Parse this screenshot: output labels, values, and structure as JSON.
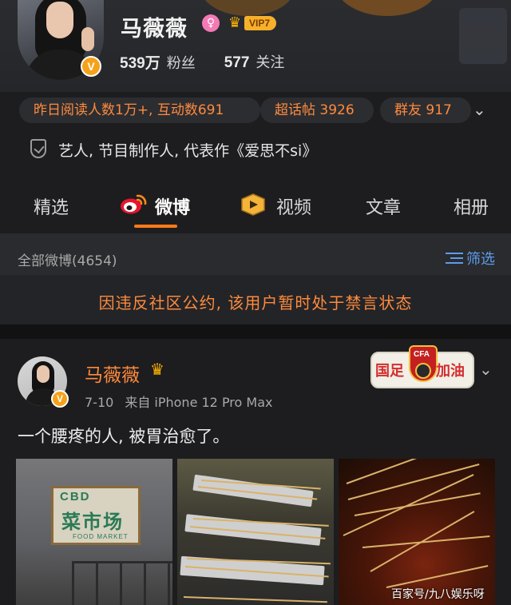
{
  "profile": {
    "name": "马薇薇",
    "vip_label": "VIP7",
    "followers_count": "539万",
    "followers_label": "粉丝",
    "following_count": "577",
    "following_label": "关注"
  },
  "metrics": {
    "reads": "昨日阅读人数1万+, 互动数691",
    "super_topic": "超话帖 3926",
    "group_friends": "群友 917"
  },
  "intro": {
    "text": "艺人, 节目制作人, 代表作《爱思不si》"
  },
  "tabs": [
    {
      "label": "精选"
    },
    {
      "label": "微博"
    },
    {
      "label": "视频"
    },
    {
      "label": "文章"
    },
    {
      "label": "相册"
    }
  ],
  "feed": {
    "title": "全部微博(4654)",
    "filter_label": "筛选"
  },
  "notice": {
    "text": "因违反社区公约, 该用户暂时处于禁言状态"
  },
  "post": {
    "author": "马薇薇",
    "date": "7-10",
    "source": "来自 iPhone 12 Pro Max",
    "text": "一个腰疼的人, 被胃治愈了。",
    "sticker_left": "国足",
    "sticker_right": "加油",
    "sticker_emblem": "CFA",
    "photo1_sign_en": "CBD",
    "photo1_sign_cn": "菜市场",
    "photo1_sign_sub": "FOOD MARKET"
  },
  "watermark": "百家号/九八娱乐呀",
  "colors": {
    "accent": "#ff8a3d",
    "link": "#5d9cec",
    "background": "#1d1d1f"
  }
}
